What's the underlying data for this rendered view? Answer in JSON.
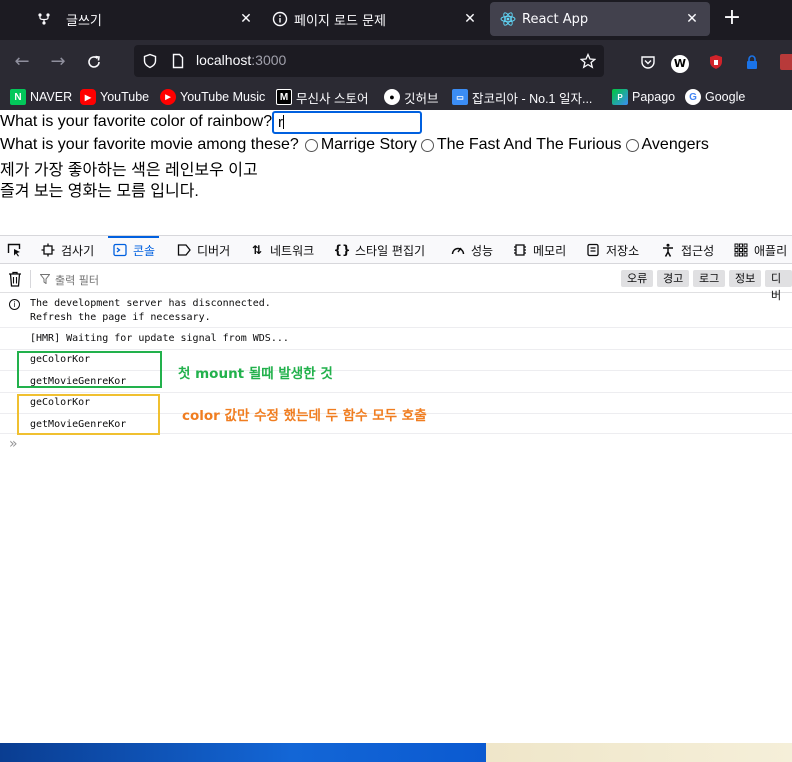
{
  "tabs": [
    {
      "title": "글쓰기",
      "icon": "git-branch-icon"
    },
    {
      "title": "페이지 로드 문제",
      "icon": "info-circle-icon"
    },
    {
      "title": "React App",
      "icon": "react-icon",
      "active": true
    }
  ],
  "nav": {
    "url_host": "localhost",
    "url_port": ":3000"
  },
  "bookmarks": [
    {
      "label": "NAVER",
      "icon": "naver-icon",
      "color": "#03c75a"
    },
    {
      "label": "YouTube",
      "icon": "youtube-icon",
      "color": "#ff0000"
    },
    {
      "label": "YouTube Music",
      "icon": "youtube-music-icon",
      "color": "#ff0000"
    },
    {
      "label": "무신사 스토어",
      "icon": "musinsa-icon",
      "color": "#000000"
    },
    {
      "label": "깃허브",
      "icon": "github-icon",
      "color": "#ffffff"
    },
    {
      "label": "잡코리아 - No.1 일자...",
      "icon": "jobkorea-icon",
      "color": "#3b8df5"
    },
    {
      "label": "Papago",
      "icon": "papago-icon",
      "color": "#00c73c"
    },
    {
      "label": "Google",
      "icon": "google-icon",
      "color": "#4285f4"
    }
  ],
  "page": {
    "q1": "What is your favorite color of rainbow?",
    "color_value": "r",
    "q2": "What is your favorite movie among these?",
    "movies": [
      "Marrige Story",
      "The Fast And The Furious",
      "Avengers"
    ],
    "line3": "제가 가장 좋아하는 색은 레인보우 이고",
    "line4": "즐겨 보는 영화는 모름 입니다."
  },
  "devtools": {
    "tabs": [
      {
        "label": "검사기",
        "icon": "inspector-icon"
      },
      {
        "label": "콘솔",
        "icon": "console-icon",
        "selected": true
      },
      {
        "label": "디버거",
        "icon": "debugger-icon"
      },
      {
        "label": "네트워크",
        "icon": "network-icon"
      },
      {
        "label": "스타일 편집기",
        "icon": "style-editor-icon"
      },
      {
        "label": "성능",
        "icon": "performance-icon"
      },
      {
        "label": "메모리",
        "icon": "memory-icon"
      },
      {
        "label": "저장소",
        "icon": "storage-icon"
      },
      {
        "label": "접근성",
        "icon": "accessibility-icon"
      },
      {
        "label": "애플리",
        "icon": "application-icon"
      }
    ],
    "filter_placeholder": "출력 필터",
    "levels": [
      "오류",
      "경고",
      "로그",
      "정보",
      "디버"
    ],
    "logs": [
      "The development server has disconnected.\nRefresh the page if necessary.",
      "[HMR] Waiting for update signal from WDS...",
      "geColorKor",
      "getMovieGenreKor",
      "geColorKor",
      "getMovieGenreKor"
    ],
    "prompt": "»"
  },
  "annotations": {
    "green_note": "첫 mount 될때 발생한 것",
    "orange_note": "color 값만 수정 했는데 두 함수 모두 호출",
    "green_color": "#22b14c",
    "orange_color": "#f0c030",
    "orange_text_color": "#f07d20"
  }
}
